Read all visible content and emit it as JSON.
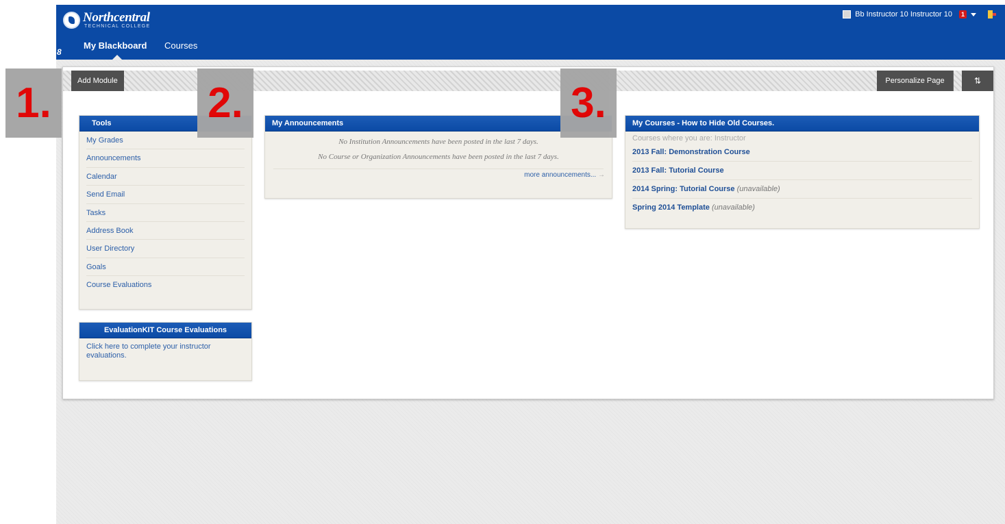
{
  "header": {
    "logo": {
      "name": "Northcentral",
      "subtitle": "TECHNICAL COLLEGE"
    },
    "tabs": [
      {
        "label": "My Blackboard",
        "active": true
      },
      {
        "label": "Courses",
        "active": false
      }
    ],
    "user": {
      "name": "Bb Instructor 10 Instructor 10",
      "notification_count": "1"
    },
    "brand_color": "#0b4aa5"
  },
  "action_bar": {
    "add_module_label": "Add Module",
    "personalize_label": "Personalize Page",
    "reorder_label": "⇅"
  },
  "tools_module": {
    "title": "Tools",
    "items": [
      "My Grades",
      "Announcements",
      "Calendar",
      "Send Email",
      "Tasks",
      "Address Book",
      "User Directory",
      "Goals",
      "Course Evaluations"
    ]
  },
  "evalkit_module": {
    "title": "EvaluationKIT Course Evaluations",
    "link_text": "Click here to complete your instructor evaluations."
  },
  "announcements_module": {
    "title": "My Announcements",
    "institution_message": "No Institution Announcements have been posted in the last 7 days.",
    "course_message": "No Course or Organization Announcements have been posted in the last 7 days.",
    "more_link": "more announcements...",
    "more_arrow": "→"
  },
  "courses_module": {
    "title": "My Courses - How to Hide Old Courses.",
    "role_label": "Courses where you are: Instructor",
    "courses": [
      {
        "name": "2013 Fall: Demonstration Course",
        "note": ""
      },
      {
        "name": "2013 Fall: Tutorial Course",
        "note": ""
      },
      {
        "name": "2014 Spring: Tutorial Course",
        "note": "(unavailable)"
      },
      {
        "name": "Spring 2014 Template",
        "note": "(unavailable)"
      }
    ]
  },
  "callouts": [
    "1.",
    "2.",
    "3."
  ]
}
